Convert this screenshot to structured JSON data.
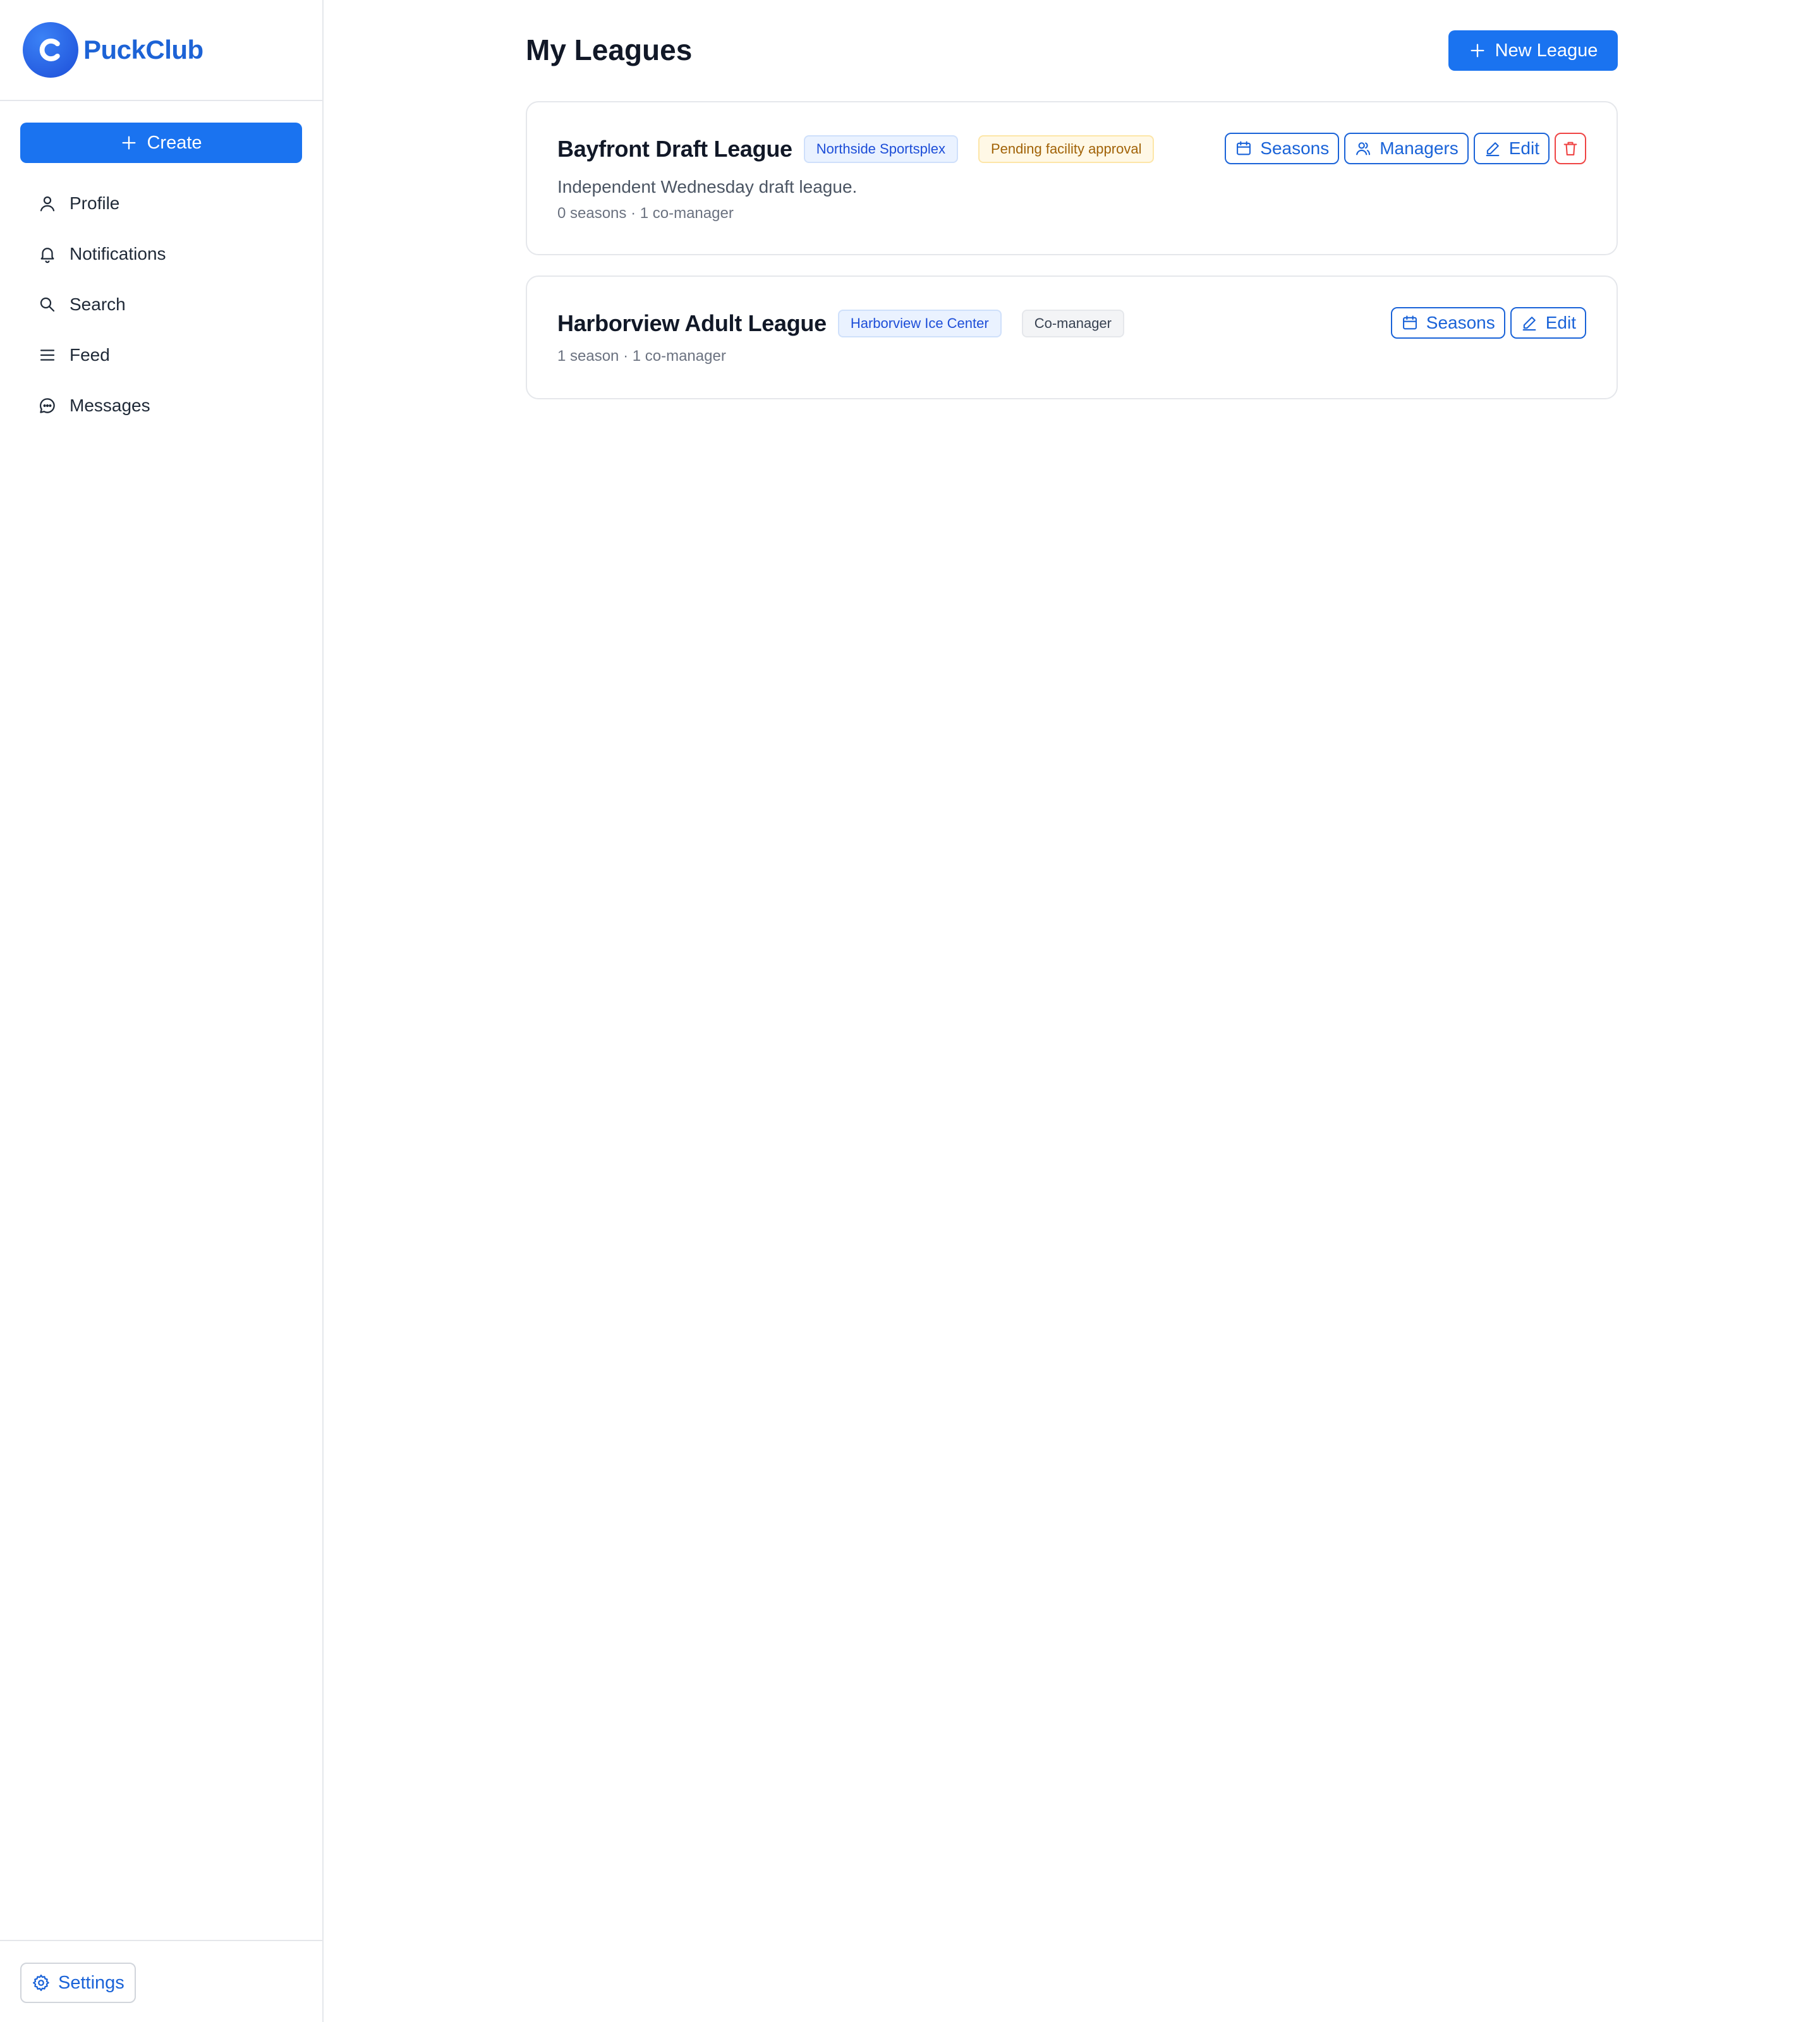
{
  "app": {
    "name": "PuckClub"
  },
  "sidebar": {
    "create_label": "Create",
    "items": [
      {
        "label": "Profile",
        "icon": "user-icon"
      },
      {
        "label": "Notifications",
        "icon": "bell-icon"
      },
      {
        "label": "Search",
        "icon": "search-icon"
      },
      {
        "label": "Feed",
        "icon": "menu-icon"
      },
      {
        "label": "Messages",
        "icon": "chat-icon"
      }
    ],
    "settings_label": "Settings"
  },
  "main": {
    "title": "My Leagues",
    "new_league_label": "New League",
    "leagues": [
      {
        "name": "Bayfront Draft League",
        "facility": "Northside Sportsplex",
        "status": "Pending facility approval",
        "description": "Independent Wednesday draft league.",
        "meta": "0 seasons · 1 co-manager",
        "actions": {
          "seasons": "Seasons",
          "managers": "Managers",
          "edit": "Edit"
        }
      },
      {
        "name": "Harborview Adult League",
        "facility": "Harborview Ice Center",
        "status": "Co-manager",
        "meta": "1 season · 1 co-manager",
        "actions": {
          "seasons": "Seasons",
          "edit": "Edit"
        }
      }
    ]
  },
  "colors": {
    "primary": "#1a73f0",
    "brand_text": "#1d63d6",
    "danger": "#ef4444",
    "pending": "#a16207"
  }
}
